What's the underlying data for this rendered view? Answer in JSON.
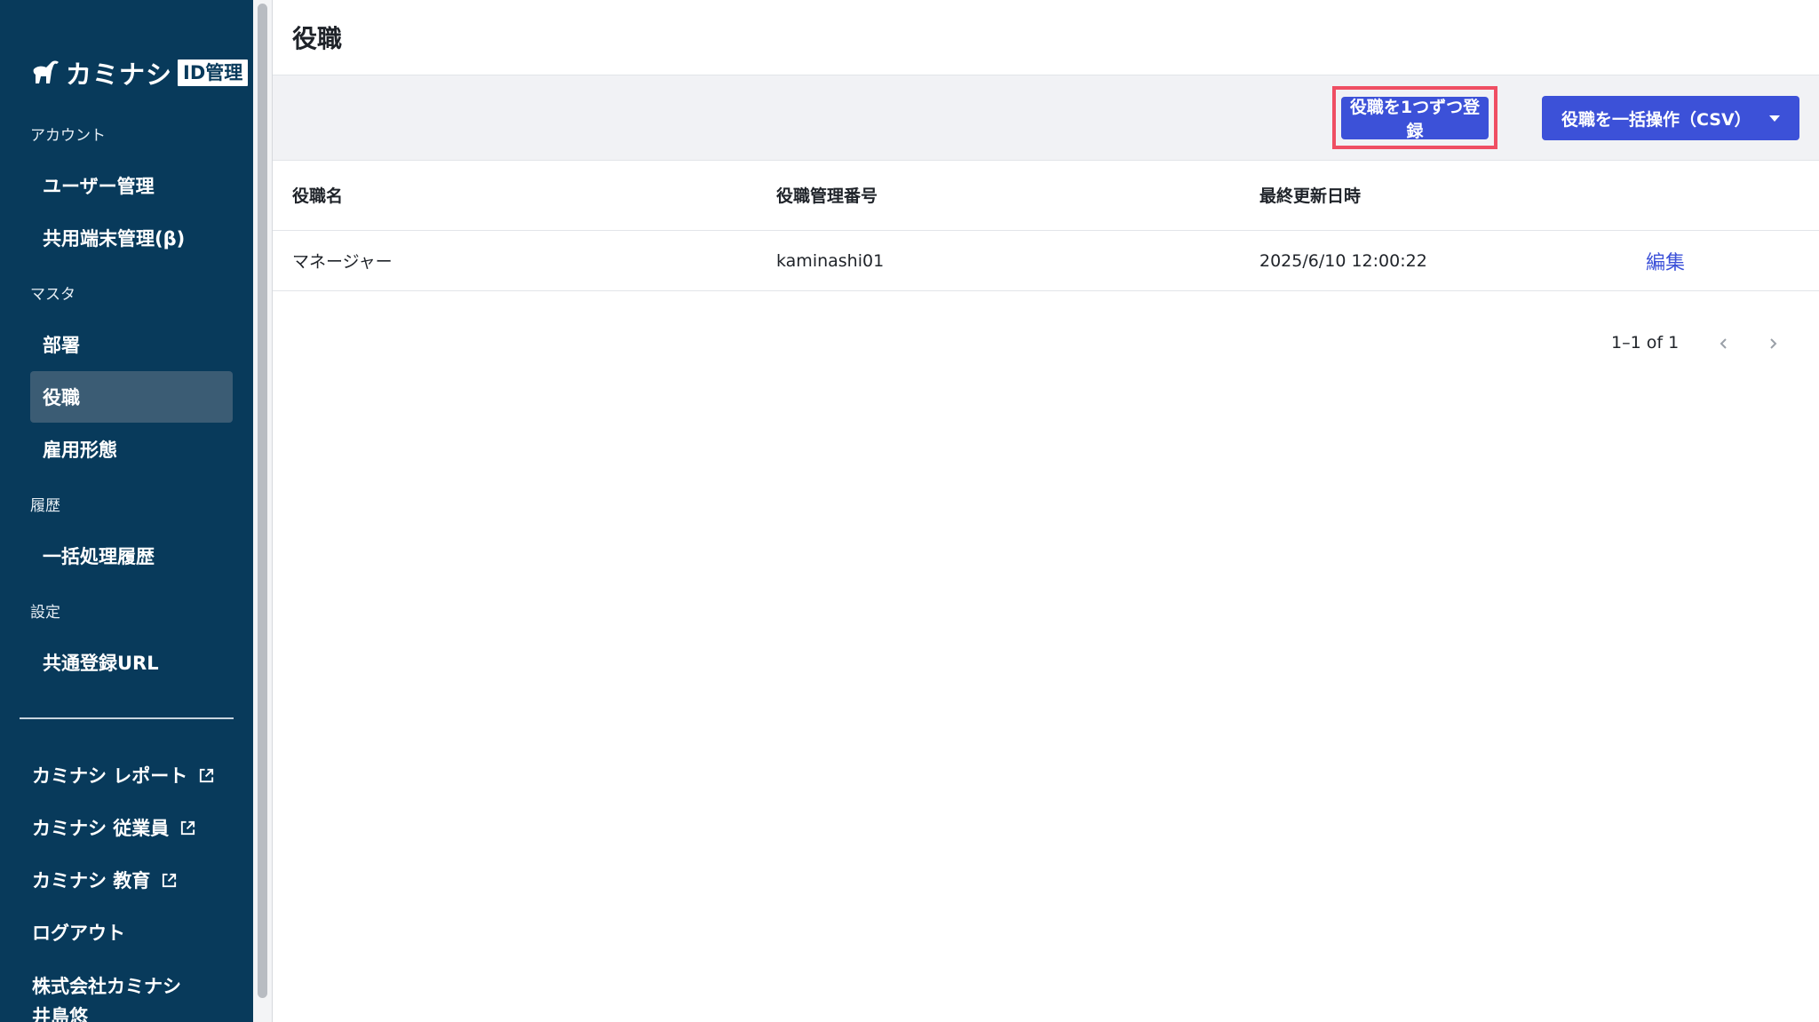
{
  "sidebar": {
    "logo": {
      "text": "カミナシ",
      "badge": "ID管理"
    },
    "sections": [
      {
        "label": "アカウント",
        "items": [
          {
            "label": "ユーザー管理"
          },
          {
            "label": "共用端末管理(β)"
          }
        ]
      },
      {
        "label": "マスタ",
        "items": [
          {
            "label": "部署"
          },
          {
            "label": "役職",
            "active": true
          },
          {
            "label": "雇用形態"
          }
        ]
      },
      {
        "label": "履歴",
        "items": [
          {
            "label": "一括処理履歴"
          }
        ]
      },
      {
        "label": "設定",
        "items": [
          {
            "label": "共通登録URL"
          }
        ]
      }
    ],
    "external_links": [
      {
        "label": "カミナシ レポート",
        "icon": "external-link-icon"
      },
      {
        "label": "カミナシ 従業員",
        "icon": "external-link-icon"
      },
      {
        "label": "カミナシ 教育",
        "icon": "external-link-icon"
      }
    ],
    "logout": "ログアウト",
    "company": "株式会社カミナシ",
    "user": "井島悠"
  },
  "header": {
    "title": "役職"
  },
  "toolbar": {
    "register_label": "役職を1つずつ登録",
    "bulk_label": "役職を一括操作（CSV）"
  },
  "table": {
    "columns": [
      "役職名",
      "役職管理番号",
      "最終更新日時"
    ],
    "rows": [
      {
        "name": "マネージャー",
        "code": "kaminashi01",
        "updated": "2025/6/10 12:00:22",
        "action": "編集"
      }
    ]
  },
  "pagination": {
    "text": "1–1 of 1"
  },
  "colors": {
    "sidebar": "#083a5b",
    "primary": "#3c51d8",
    "highlight": "#ef4e63"
  }
}
